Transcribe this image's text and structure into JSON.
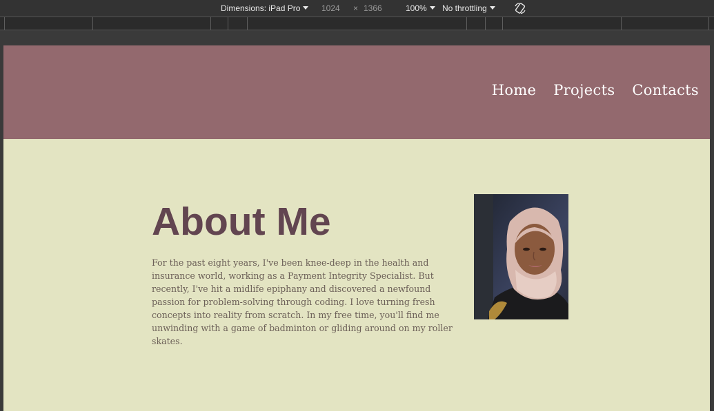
{
  "devtools": {
    "dimensions_label": "Dimensions: iPad Pro",
    "width": "1024",
    "times": "×",
    "height": "1366",
    "zoom": "100%",
    "throttling": "No throttling",
    "rotate_icon": "rotate-icon"
  },
  "site": {
    "header_color": "#93696e",
    "background_color": "#e3e4c2",
    "nav": {
      "home": "Home",
      "projects": "Projects",
      "contacts": "Contacts"
    },
    "about": {
      "title": "About Me",
      "title_color": "#624550",
      "body": "For the past eight years, I've been knee-deep in the health and insurance world, working as a Payment Integrity Specialist. But recently, I've hit a midlife epiphany and discovered a newfound passion for problem-solving through coding. I love turning fresh concepts into reality from scratch. In my free time, you'll find me unwinding with a game of badminton or gliding around on my roller skates."
    }
  }
}
